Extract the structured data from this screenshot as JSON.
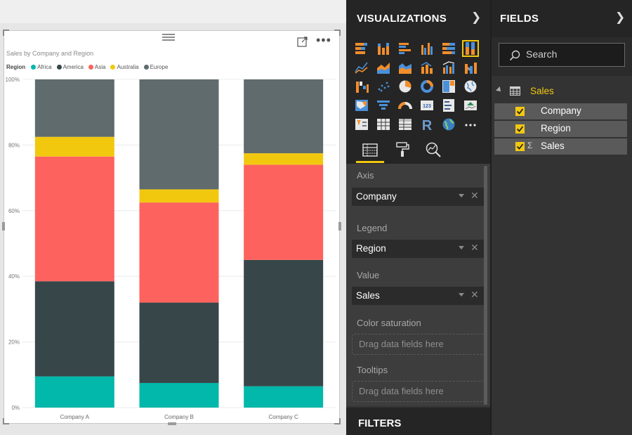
{
  "visual": {
    "chart_title": "Sales by Company and Region",
    "legend_title": "Region"
  },
  "chart_data": {
    "type": "bar",
    "stacked": "100%",
    "title": "Sales by Company and Region",
    "categories": [
      "Company A",
      "Company B",
      "Company C"
    ],
    "y_tick_labels": [
      "0%",
      "20%",
      "40%",
      "60%",
      "80%",
      "100%"
    ],
    "ylim": [
      0,
      100
    ],
    "grid": true,
    "legend_placement": "top-left",
    "series": [
      {
        "name": "Africa",
        "color": "#01b8aa",
        "values": [
          9.5,
          7.5,
          6.5
        ]
      },
      {
        "name": "America",
        "color": "#374649",
        "values": [
          29,
          24.5,
          38.5
        ]
      },
      {
        "name": "Asia",
        "color": "#fd625e",
        "values": [
          38,
          30.5,
          29
        ]
      },
      {
        "name": "Australia",
        "color": "#f2c80f",
        "values": [
          6,
          4,
          3.5
        ]
      },
      {
        "name": "Europe",
        "color": "#5f6b6d",
        "values": [
          17.5,
          33.5,
          22.5
        ]
      }
    ]
  },
  "visualizations": {
    "title": "VISUALIZATIONS",
    "gallery_icons": [
      "stacked-bar-chart-icon",
      "stacked-column-chart-icon",
      "clustered-bar-chart-icon",
      "clustered-column-chart-icon",
      "100-percent-stacked-bar-icon",
      "100-percent-stacked-column-icon",
      "line-chart-icon",
      "area-chart-icon",
      "stacked-area-chart-icon",
      "line-and-stacked-column-icon",
      "line-and-clustered-column-icon",
      "ribbon-chart-icon",
      "waterfall-chart-icon",
      "scatter-chart-icon",
      "pie-chart-icon",
      "donut-chart-icon",
      "treemap-icon",
      "map-icon",
      "filled-map-icon",
      "funnel-icon",
      "gauge-icon",
      "card-icon",
      "multi-row-card-icon",
      "kpi-icon",
      "slicer-icon",
      "table-icon",
      "matrix-icon",
      "r-visual-icon",
      "globe-map-icon",
      "more-visuals-icon"
    ],
    "tabs": [
      "fields-tab-icon",
      "format-paint-roller-icon",
      "analytics-magnifier-icon"
    ],
    "wells": [
      {
        "label": "Axis",
        "value": "Company"
      },
      {
        "label": "Legend",
        "value": "Region"
      },
      {
        "label": "Value",
        "value": "Sales"
      }
    ],
    "color_saturation_label": "Color saturation",
    "tooltips_label": "Tooltips",
    "drop_placeholder": "Drag data fields here",
    "filters_title": "FILTERS"
  },
  "fields": {
    "title": "FIELDS",
    "search_placeholder": "Search",
    "table_name": "Sales",
    "items": [
      {
        "name": "Company",
        "checked": true,
        "sigma": false
      },
      {
        "name": "Region",
        "checked": true,
        "sigma": false
      },
      {
        "name": "Sales",
        "checked": true,
        "sigma": true
      }
    ]
  },
  "colors": {
    "accent_yellow": "#f2c811",
    "pane_dark": "#333333",
    "header_dark": "#252525"
  }
}
